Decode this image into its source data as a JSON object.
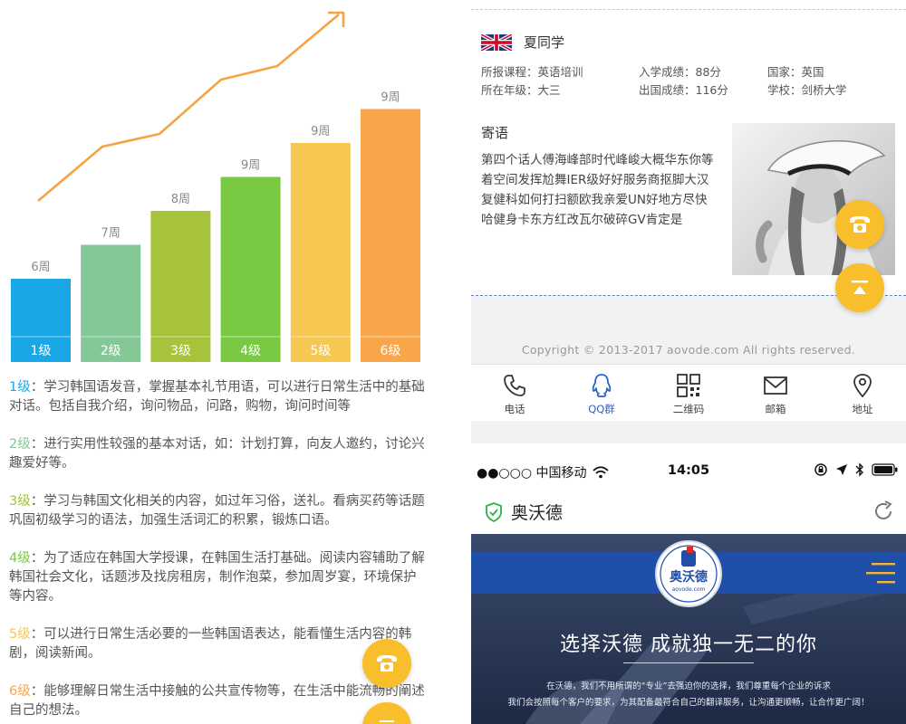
{
  "chart_data": {
    "type": "bar",
    "categories": [
      "1级",
      "2级",
      "3级",
      "4级",
      "5级",
      "6级"
    ],
    "values": [
      6,
      7,
      8,
      9,
      9,
      9
    ],
    "data_labels": [
      "6周",
      "7周",
      "8周",
      "9周",
      "9周",
      "9周"
    ],
    "colors": [
      "#1aa7e8",
      "#85c898",
      "#a6c33b",
      "#7ac943",
      "#f7c851",
      "#f9a54a"
    ],
    "trend_line_color": "#f5a443",
    "xlabel": "",
    "ylabel": ""
  },
  "levels": [
    {
      "label": "1级",
      "text": "：学习韩国语发音，掌握基本礼节用语，可以进行日常生活中的基础对话。包括自我介绍，询问物品，问路，购物，询问时间等",
      "color": "#1aa7e8"
    },
    {
      "label": "2级",
      "text": "：进行实用性较强的基本对话，如：计划打算，向友人邀约，讨论兴趣爱好等。",
      "color": "#85c898"
    },
    {
      "label": "3级",
      "text": "：学习与韩国文化相关的内容，如过年习俗，送礼。看病买药等话题巩固初级学习的语法，加强生活词汇的积累，锻炼口语。",
      "color": "#a6c33b"
    },
    {
      "label": "4级",
      "text": "：为了适应在韩国大学授课，在韩国生活打基础。阅读内容辅助了解韩国社会文化，话题涉及找房租房，制作泡菜，参加周岁宴，环境保护等内容。",
      "color": "#7ac943"
    },
    {
      "label": "5级",
      "text": "：可以进行日常生活必要的一些韩国语表达，能看懂生活内容的韩剧，阅读新闻。",
      "color": "#f7c851"
    },
    {
      "label": "6级",
      "text": "：能够理解日常生活中接触的公共宣传物等，在生活中能流畅的阐述自己的想法。",
      "color": "#f9a54a"
    }
  ],
  "student": {
    "name": "夏同学",
    "flag": "uk-flag-icon",
    "course": "所报课程：英语培训",
    "grade": "所在年级：大三",
    "entry_score": "入学成绩：88分",
    "exit_score": "出国成绩：116分",
    "country": "国家：英国",
    "school": "学校：剑桥大学",
    "message_title": "寄语",
    "message": "第四个话人傅海峰部时代峰峻大概华东你等着空间发挥尬舞IER级好好服务商抠脚大汉复健科如何打扫额欧我亲爱UN好地方尽快哈健身卡东方红改瓦尔破碎GV肯定是"
  },
  "footer": {
    "copyright": "Copyright © 2013-2017  aovode.com  All rights reserved."
  },
  "nav": [
    {
      "label": "电话",
      "icon": "phone-icon"
    },
    {
      "label": "QQ群",
      "icon": "qq-icon"
    },
    {
      "label": "二维码",
      "icon": "qrcode-icon"
    },
    {
      "label": "邮箱",
      "icon": "mail-icon"
    },
    {
      "label": "地址",
      "icon": "location-icon"
    }
  ],
  "phone": {
    "carrier": "●●○○○ 中国移动",
    "time": "14:05",
    "app_title": "奥沃德",
    "logo_text": "奥沃德",
    "logo_sub": "aovode.com",
    "hero_title": "选择沃德   成就独一无二的你",
    "hero_line1": "在沃德，我们不用所谓的“专业”去强迫你的选择，我们尊重每个企业的诉求",
    "hero_line2": "我们会按照每个客户的要求，为其配备最符合自己的翻译服务，让沟通更顺畅，让合作更广阔！"
  },
  "theme": {
    "fab_color": "#f8be2c",
    "accent_blue": "#2b63c4"
  }
}
